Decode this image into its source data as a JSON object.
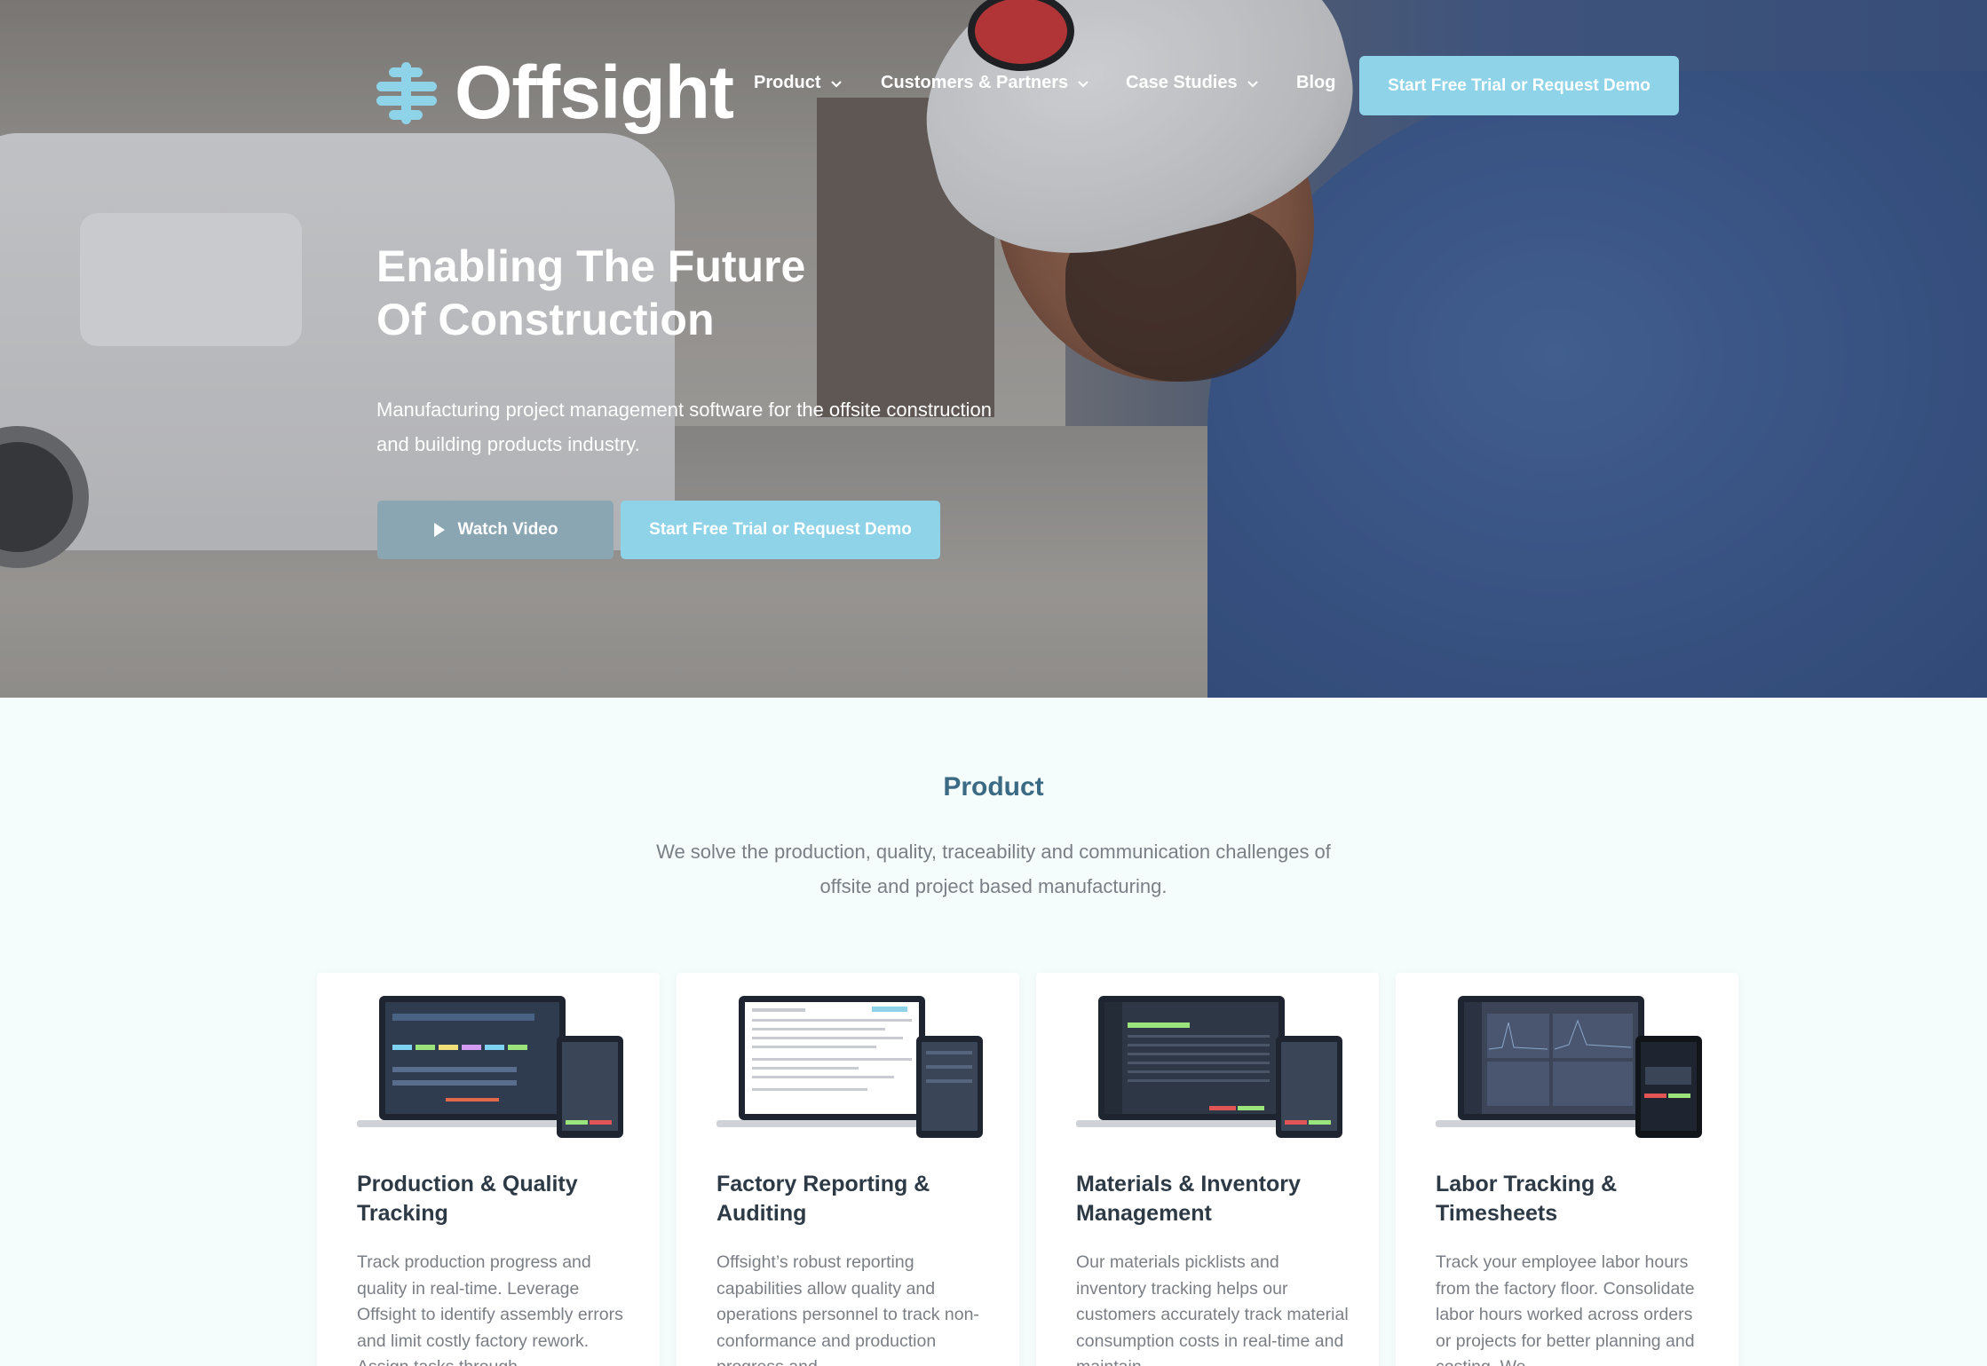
{
  "brand": {
    "name": "Offsight",
    "accent": "#8fd3e8"
  },
  "nav": {
    "items": [
      {
        "label": "Product",
        "has_dropdown": true
      },
      {
        "label": "Customers & Partners",
        "has_dropdown": true
      },
      {
        "label": "Case Studies",
        "has_dropdown": true
      },
      {
        "label": "Blog",
        "has_dropdown": false
      }
    ],
    "cta": "Start Free Trial or Request Demo"
  },
  "hero": {
    "title_line1": "Enabling The Future",
    "title_line2": "Of Construction",
    "subtitle": "Manufacturing project management software for the offsite construction and building products industry.",
    "watch_video": "Watch Video",
    "cta": "Start Free Trial or Request Demo"
  },
  "product": {
    "title": "Product",
    "subtitle": "We solve the production, quality, traceability and communication challenges of offsite and project based manufacturing.",
    "cards": [
      {
        "title": "Production & Quality Tracking",
        "text": "Track production progress and quality in real-time. Leverage Offsight to identify assembly errors and limit costly factory rework. Assign tasks through"
      },
      {
        "title": "Factory Reporting & Auditing",
        "text": "Offsight’s robust reporting capabilities allow quality and operations personnel to track non-conformance and production progress and"
      },
      {
        "title": "Materials & Inventory Management",
        "text": "Our materials picklists and inventory tracking helps our customers accurately track material consumption costs in real-time and maintain"
      },
      {
        "title": "Labor Tracking & Timesheets",
        "text": "Track your employee labor hours from the factory floor. Consolidate labor hours worked across orders or projects for better planning and costing. We"
      }
    ]
  }
}
